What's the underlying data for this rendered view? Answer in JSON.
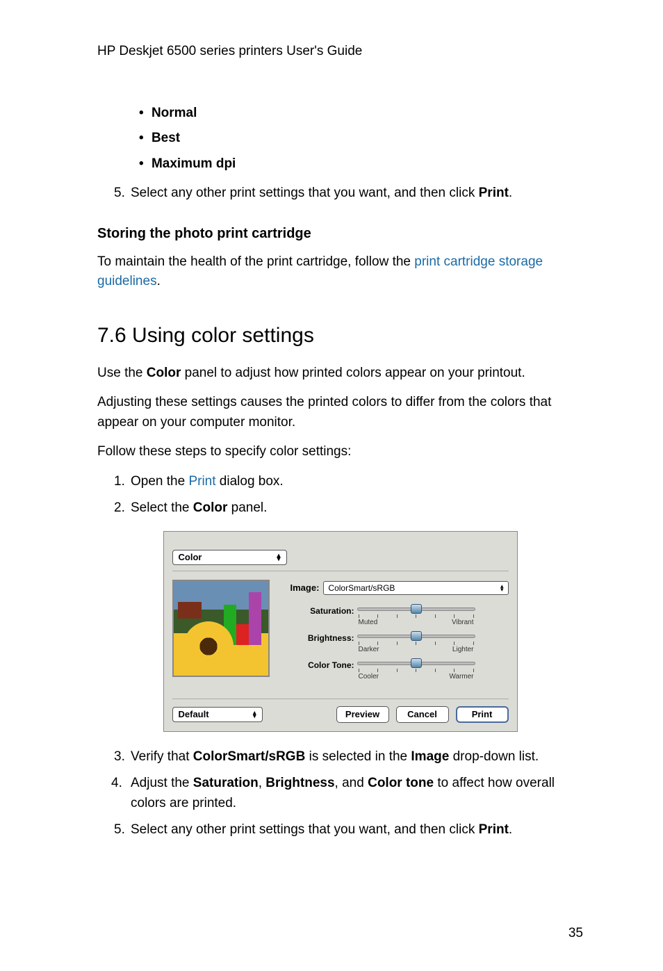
{
  "header": "HP Deskjet 6500 series printers User's Guide",
  "bullets": [
    "Normal",
    "Best",
    "Maximum dpi"
  ],
  "step5_pre": "Select any other print settings that you want, and then click ",
  "step5_bold": "Print",
  "step5_post": ".",
  "storing_heading": "Storing the photo print cartridge",
  "storing_para_pre": "To maintain the health of the print cartridge, follow the ",
  "storing_link": "print cartridge storage guidelines",
  "storing_para_post": ".",
  "section_title": "7.6  Using color settings",
  "para1_pre": "Use the ",
  "para1_bold": "Color",
  "para1_post": " panel to adjust how printed colors appear on your printout.",
  "para2": "Adjusting these settings causes the printed colors to differ from the colors that appear on your computer monitor.",
  "para3": "Follow these steps to specify color settings:",
  "steps": {
    "s1_pre": "Open the ",
    "s1_link": "Print",
    "s1_post": " dialog box.",
    "s2_pre": "Select the ",
    "s2_bold": "Color",
    "s2_post": " panel.",
    "s3_pre": "Verify that ",
    "s3_bold1": "ColorSmart/sRGB",
    "s3_mid": " is selected in the ",
    "s3_bold2": "Image",
    "s3_post": " drop-down list.",
    "s4_pre": "Adjust the ",
    "s4_bold1": "Saturation",
    "s4_mid1": ", ",
    "s4_bold2": "Brightness",
    "s4_mid2": ", and ",
    "s4_bold3": "Color tone",
    "s4_post": " to affect how overall colors are printed.",
    "s5_pre": "Select any other print settings that you want, and then click ",
    "s5_bold": "Print",
    "s5_post": "."
  },
  "figure": {
    "panel_select": "Color",
    "image_label": "Image:",
    "image_value": "ColorSmart/sRGB",
    "saturation_label": "Saturation:",
    "sat_min": "Muted",
    "sat_max": "Vibrant",
    "brightness_label": "Brightness:",
    "bri_min": "Darker",
    "bri_max": "Lighter",
    "colortone_label": "Color Tone:",
    "ct_min": "Cooler",
    "ct_max": "Warmer",
    "default": "Default",
    "preview": "Preview",
    "cancel": "Cancel",
    "print": "Print"
  },
  "page_number": "35"
}
